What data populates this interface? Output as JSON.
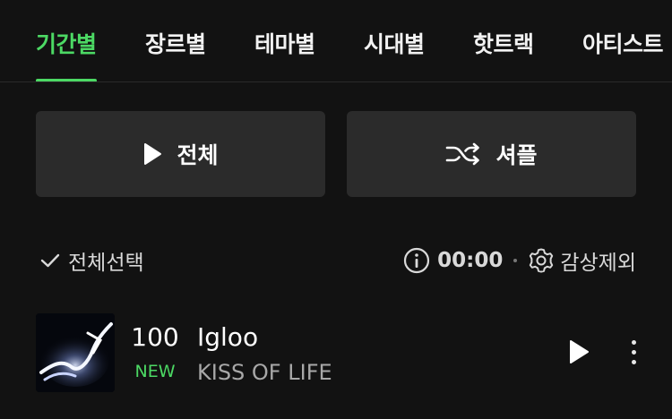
{
  "tabs": [
    {
      "label": "기간별",
      "active": true
    },
    {
      "label": "장르별",
      "active": false
    },
    {
      "label": "테마별",
      "active": false
    },
    {
      "label": "시대별",
      "active": false
    },
    {
      "label": "핫트랙",
      "active": false
    },
    {
      "label": "아티스트",
      "active": false
    }
  ],
  "actions": {
    "play_all_label": "전체",
    "shuffle_label": "셔플"
  },
  "toolbar": {
    "select_all_label": "전체선택",
    "timer_value": "00:00",
    "exclude_label": "감상제외"
  },
  "tracks": [
    {
      "rank": "100",
      "badge": "NEW",
      "title": "Igloo",
      "artist": "KISS OF LIFE"
    }
  ],
  "icons": {
    "play": "play-icon",
    "shuffle": "shuffle-icon",
    "check": "check-icon",
    "info": "info-icon",
    "gear": "gear-icon",
    "more": "more-vertical-icon"
  },
  "colors": {
    "background": "#121212",
    "accent": "#4cd964",
    "button_bg": "#2b2b2b",
    "secondary_text": "#a8a8a8"
  }
}
